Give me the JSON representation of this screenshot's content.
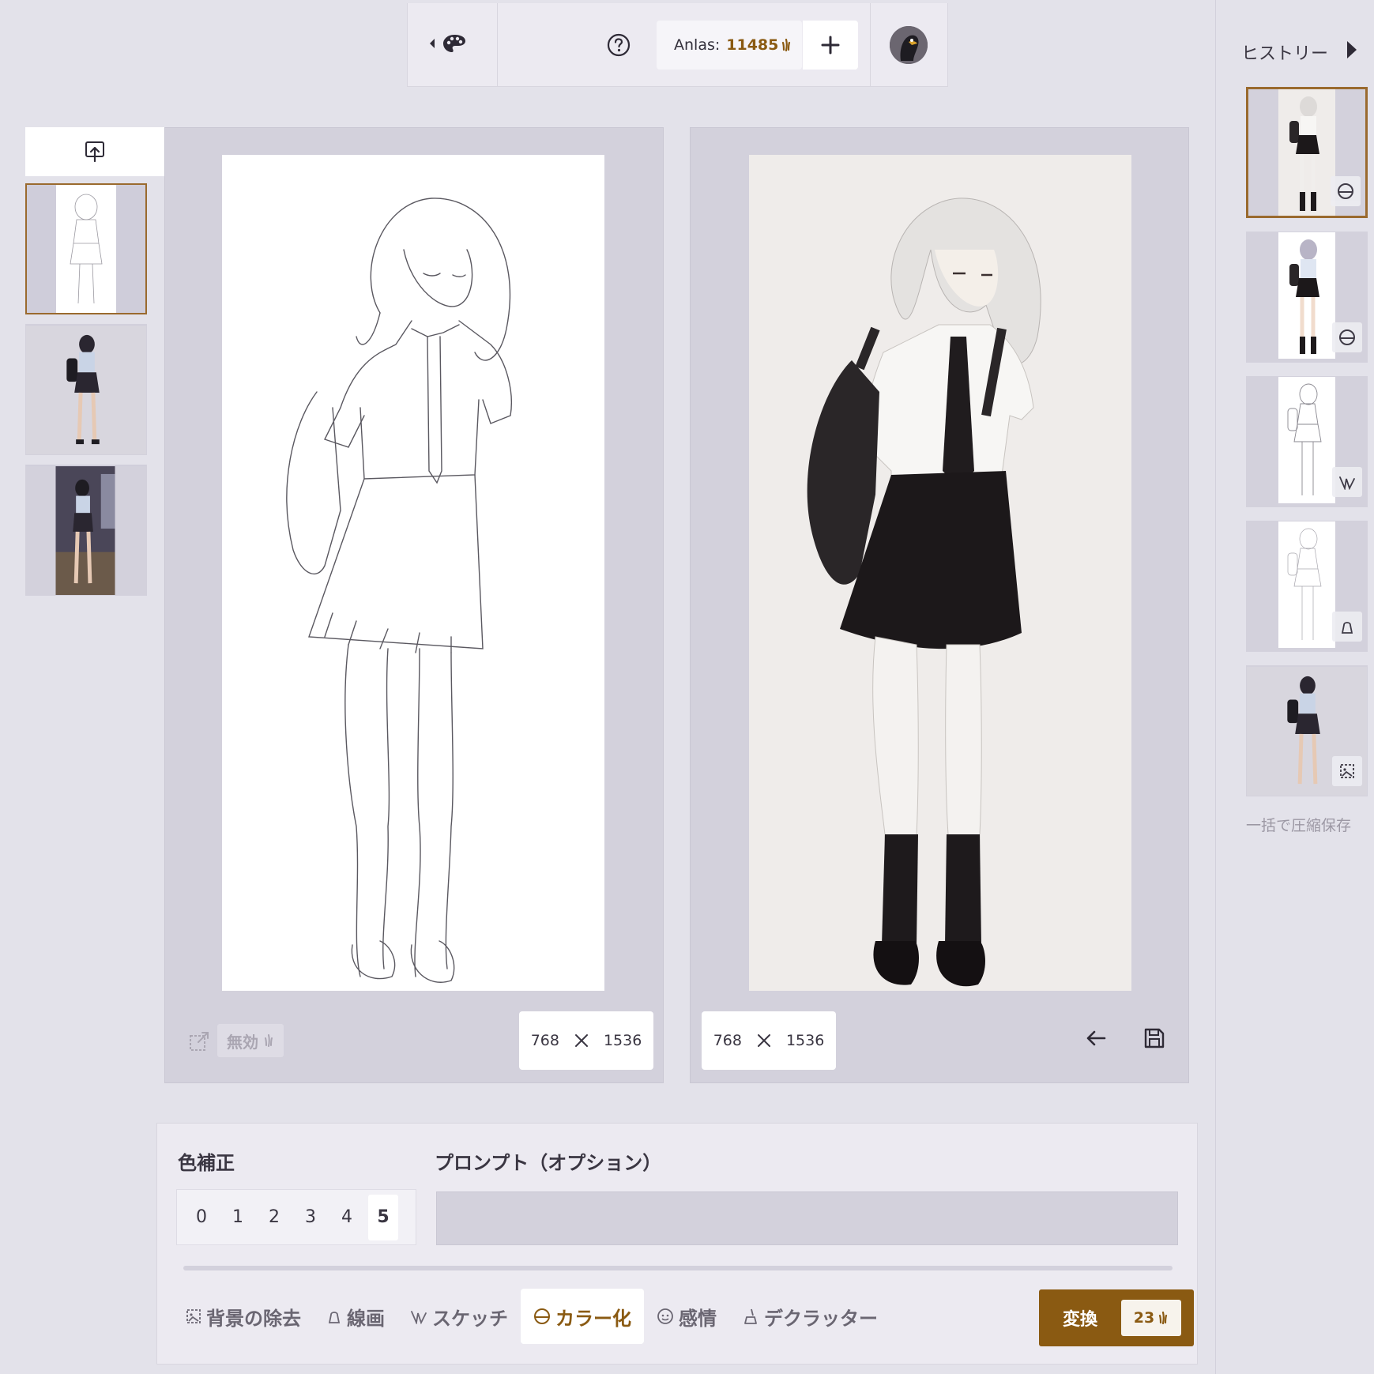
{
  "topbar": {
    "anlas_label": "Anlas:",
    "anlas_value": "11485",
    "colors": {
      "accent": "#8a5a12",
      "bg": "#e3e2ea"
    }
  },
  "left_panel": {
    "disabled_label": "無効",
    "dims": {
      "width": "768",
      "height": "1536"
    }
  },
  "right_panel": {
    "dims": {
      "width": "768",
      "height": "1536"
    }
  },
  "controls": {
    "color_correction_title": "色補正",
    "levels": [
      "0",
      "1",
      "2",
      "3",
      "4",
      "5"
    ],
    "selected_level": "5",
    "prompt_title": "プロンプト（オプション）",
    "prompt_value": "",
    "tabs": [
      {
        "label": "背景の除去",
        "icon": "bg-remove-icon"
      },
      {
        "label": "線画",
        "icon": "lineart-icon"
      },
      {
        "label": "スケッチ",
        "icon": "sketch-icon"
      },
      {
        "label": "カラー化",
        "icon": "colorize-icon",
        "active": true
      },
      {
        "label": "感情",
        "icon": "emotion-icon"
      },
      {
        "label": "デクラッター",
        "icon": "declutter-icon"
      }
    ],
    "convert_label": "変換",
    "convert_cost": "23"
  },
  "history": {
    "title": "ヒストリー",
    "zip_label": "一括で圧縮保存",
    "items": [
      {
        "badge": "colorize-icon"
      },
      {
        "badge": "colorize-icon"
      },
      {
        "badge": "sketch-icon"
      },
      {
        "badge": "lineart-icon"
      },
      {
        "badge": "bg-remove-icon"
      }
    ]
  }
}
